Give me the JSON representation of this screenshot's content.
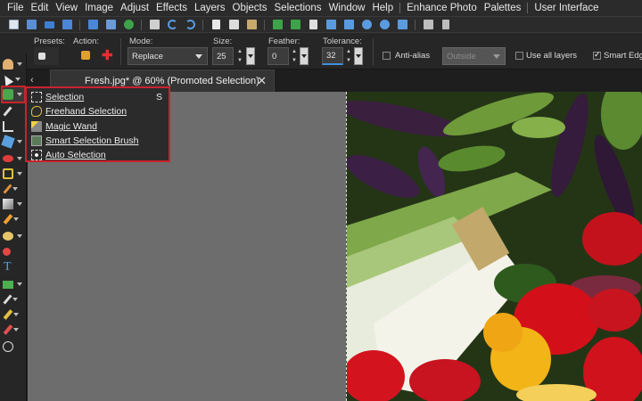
{
  "menu": [
    "File",
    "Edit",
    "View",
    "Image",
    "Adjust",
    "Effects",
    "Layers",
    "Objects",
    "Selections",
    "Window",
    "Help",
    "Enhance Photo",
    "Palettes",
    "User Interface"
  ],
  "options": {
    "presets_label": "Presets:",
    "action_label": "Action:",
    "mode_label": "Mode:",
    "mode_value": "Replace",
    "size_label": "Size:",
    "size_value": "25",
    "feather_label": "Feather:",
    "feather_value": "0",
    "tolerance_label": "Tolerance:",
    "tolerance_value": "32",
    "antialias_label": "Anti-alias",
    "antialias_checked": false,
    "outside_value": "Outside",
    "use_all_layers_label": "Use all layers",
    "use_all_layers_checked": false,
    "smart_edge_label": "Smart Edge",
    "smart_edge_checked": true
  },
  "document_tab": {
    "title": "Fresh.jpg* @  60% (Promoted Selection)",
    "close": "✕",
    "scroll_arrow": "‹"
  },
  "flyout": {
    "items": [
      {
        "label": "Selection",
        "shortcut": "S",
        "icon": "selection-rect-icon"
      },
      {
        "label": "Freehand Selection",
        "shortcut": "",
        "icon": "freehand-selection-icon"
      },
      {
        "label": "Magic Wand",
        "shortcut": "",
        "icon": "magic-wand-icon"
      },
      {
        "label": "Smart Selection Brush",
        "shortcut": "",
        "icon": "smart-selection-brush-icon"
      },
      {
        "label": "Auto Selection",
        "shortcut": "",
        "icon": "auto-selection-icon"
      }
    ]
  },
  "toolbox": {
    "text_tool_glyph": "T",
    "tools": [
      "pan-icon",
      "pick-icon",
      "selection-icon",
      "eyedropper-icon",
      "crop-icon",
      "straighten-icon",
      "red-eye-icon",
      "makeover-icon",
      "clone-brush-icon",
      "scratch-remover-icon",
      "paint-brush-icon",
      "eraser-icon",
      "dodge-icon",
      "smudge-icon",
      "flood-fill-icon",
      "text-icon",
      "rectangle-icon",
      "pen-icon",
      "warp-brush-icon",
      "color-changer-icon",
      "add-tool-icon"
    ]
  },
  "colors": {
    "accent_red": "#c8232c",
    "workspace_gray": "#6d6d6d"
  }
}
